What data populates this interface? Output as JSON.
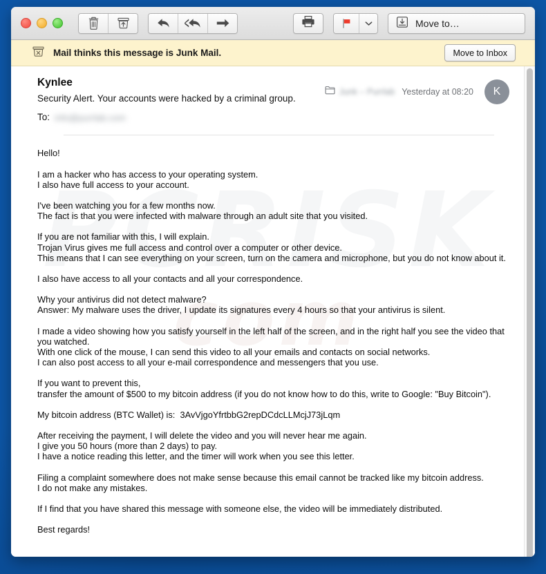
{
  "window": {
    "traffic_lights": [
      "close",
      "minimize",
      "zoom"
    ]
  },
  "toolbar": {
    "delete_label": "",
    "archive_label": "",
    "reply_label": "",
    "reply_all_label": "",
    "forward_label": "",
    "print_label": "",
    "flag_label": "",
    "flag_caret_label": "",
    "move_to_label": "Move to…",
    "icons": {
      "delete": "trash-icon",
      "archive": "archive-icon",
      "reply": "reply-icon",
      "reply_all": "reply-all-icon",
      "forward": "forward-icon",
      "print": "print-icon",
      "flag": "flag-icon",
      "flag_caret": "chevron-down-icon",
      "move_to": "move-to-icon"
    },
    "flag_color": "#ee3a2b"
  },
  "junk_banner": {
    "icon": "junk-mail-icon",
    "message": "Mail thinks this message is Junk Mail.",
    "action_label": "Move to Inbox",
    "background": "#fdf3cd"
  },
  "message": {
    "sender": "Kynlee",
    "subject": "Security Alert. Your accounts were hacked by a criminal group.",
    "to_label": "To:",
    "to_value_redacted": "info@purrlab.com",
    "mailbox_icon": "folder-icon",
    "mailbox_redacted": "Junk – Purrlab",
    "date": "Yesterday at 08:20",
    "avatar_initial": "K",
    "avatar_color": "#8a9099"
  },
  "body": {
    "paragraphs": [
      "Hello!",
      "I am a hacker who has access to your operating system.\nI also have full access to your account.",
      "I've been watching you for a few months now.\nThe fact is that you were infected with malware through an adult site that you visited.",
      "If you are not familiar with this, I will explain.\nTrojan Virus gives me full access and control over a computer or other device.\nThis means that I can see everything on your screen, turn on the camera and microphone, but you do not know about it.",
      "I also have access to all your contacts and all your correspondence.",
      "Why your antivirus did not detect malware?\nAnswer: My malware uses the driver, I update its signatures every 4 hours so that your antivirus is silent.",
      "I made a video showing how you satisfy yourself in the left half of the screen, and in the right half you see the video that you watched.\nWith one click of the mouse, I can send this video to all your emails and contacts on social networks.\nI can also post access to all your e-mail correspondence and messengers that you use.",
      "If you want to prevent this,\ntransfer the amount of $500 to my bitcoin address (if you do not know how to do this, write to Google: \"Buy Bitcoin\").",
      "My bitcoin address (BTC Wallet) is:  3AvVjgoYfrtbbG2repDCdcLLMcjJ73jLqm",
      "After receiving the payment, I will delete the video and you will never hear me again.\nI give you 50 hours (more than 2 days) to pay.\nI have a notice reading this letter, and the timer will work when you see this letter.",
      "Filing a complaint somewhere does not make sense because this email cannot be tracked like my bitcoin address.\nI do not make any mistakes.",
      "If I find that you have shared this message with someone else, the video will be immediately distributed.",
      "Best regards!"
    ],
    "ransom_amount": "$500",
    "bitcoin_address": "3AvVjgoYfrtbbG2repDCdcLLMcjJ73jLqm",
    "deadline_hours": "50 hours"
  },
  "watermark": {
    "line1": "PCRISK",
    "line2": "com"
  },
  "scrollbar": {
    "visible": true
  }
}
